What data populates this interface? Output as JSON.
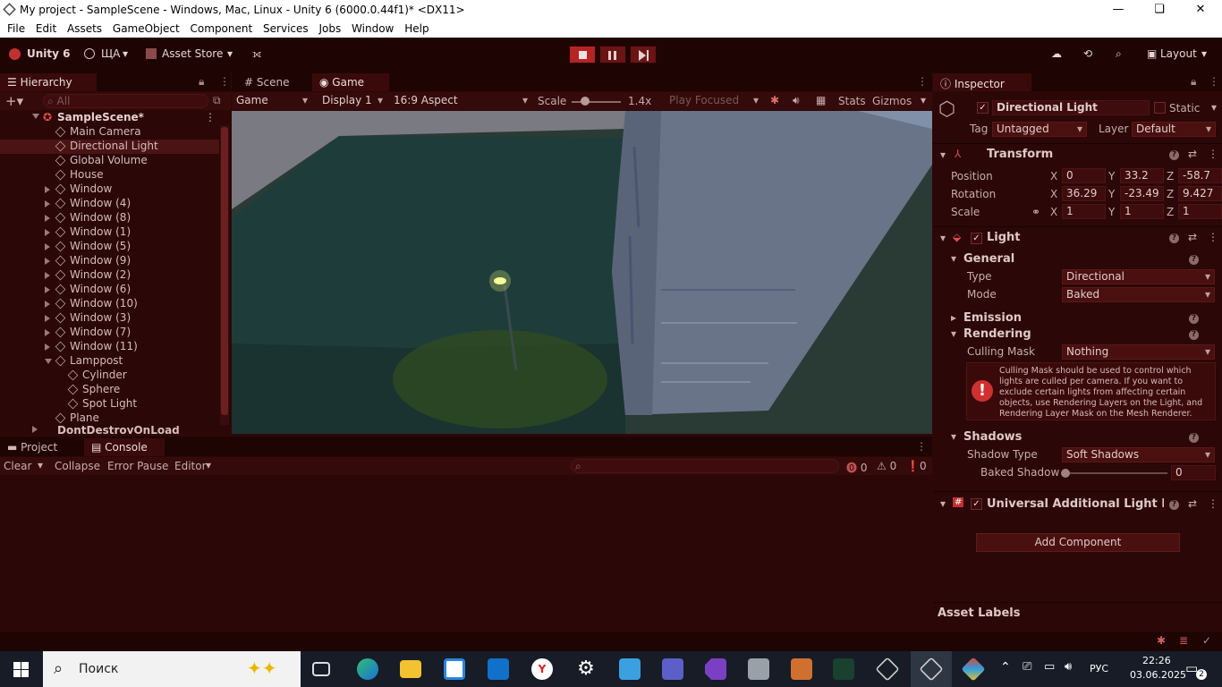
{
  "window": {
    "title": "My project - SampleScene - Windows, Mac, Linux - Unity 6 (6000.0.44f1)* <DX11>"
  },
  "menu": [
    "File",
    "Edit",
    "Assets",
    "GameObject",
    "Component",
    "Services",
    "Jobs",
    "Window",
    "Help"
  ],
  "toolbar": {
    "unity": "Unity 6",
    "account": "ЩА",
    "asset_store": "Asset Store",
    "layout": "Layout"
  },
  "hierarchy": {
    "tab": "Hierarchy",
    "search_placeholder": "All",
    "scene": "SampleScene*",
    "items": [
      {
        "label": "Main Camera",
        "indent": 1,
        "arrow": ""
      },
      {
        "label": "Directional Light",
        "indent": 1,
        "arrow": "",
        "selected": true
      },
      {
        "label": "Global Volume",
        "indent": 1,
        "arrow": ""
      },
      {
        "label": "House",
        "indent": 1,
        "arrow": ""
      },
      {
        "label": "Window",
        "indent": 1,
        "arrow": "right"
      },
      {
        "label": "Window (4)",
        "indent": 1,
        "arrow": "right"
      },
      {
        "label": "Window (8)",
        "indent": 1,
        "arrow": "right"
      },
      {
        "label": "Window (1)",
        "indent": 1,
        "arrow": "right"
      },
      {
        "label": "Window (5)",
        "indent": 1,
        "arrow": "right"
      },
      {
        "label": "Window (9)",
        "indent": 1,
        "arrow": "right"
      },
      {
        "label": "Window (2)",
        "indent": 1,
        "arrow": "right"
      },
      {
        "label": "Window (6)",
        "indent": 1,
        "arrow": "right"
      },
      {
        "label": "Window (10)",
        "indent": 1,
        "arrow": "right"
      },
      {
        "label": "Window (3)",
        "indent": 1,
        "arrow": "right"
      },
      {
        "label": "Window (7)",
        "indent": 1,
        "arrow": "right"
      },
      {
        "label": "Window (11)",
        "indent": 1,
        "arrow": "right"
      },
      {
        "label": "Lamppost",
        "indent": 1,
        "arrow": "down"
      },
      {
        "label": "Cylinder",
        "indent": 2,
        "arrow": ""
      },
      {
        "label": "Sphere",
        "indent": 2,
        "arrow": ""
      },
      {
        "label": "Spot Light",
        "indent": 2,
        "arrow": ""
      },
      {
        "label": "Plane",
        "indent": 1,
        "arrow": ""
      }
    ],
    "dont_destroy": "DontDestroyOnLoad"
  },
  "viewtabs": {
    "scene": "Scene",
    "game": "Game"
  },
  "gamebar": {
    "mode": "Game",
    "display": "Display 1",
    "aspect": "16:9 Aspect",
    "scale_label": "Scale",
    "scale_value": "1.4x",
    "play_focused": "Play Focused",
    "stats": "Stats",
    "gizmos": "Gizmos"
  },
  "bottom": {
    "project": "Project",
    "console": "Console",
    "clear": "Clear",
    "collapse": "Collapse",
    "error_pause": "Error Pause",
    "editor": "Editor",
    "errors": "0",
    "warnings": "0",
    "logs": "0"
  },
  "inspector": {
    "tab": "Inspector",
    "name": "Directional Light",
    "static": "Static",
    "tag_label": "Tag",
    "tag": "Untagged",
    "layer_label": "Layer",
    "layer": "Default",
    "transform": {
      "title": "Transform",
      "position": {
        "label": "Position",
        "x": "0",
        "y": "33.2",
        "z": "-58.7"
      },
      "rotation": {
        "label": "Rotation",
        "x": "36.29",
        "y": "-23.49",
        "z": "9.427"
      },
      "scale": {
        "label": "Scale",
        "x": "1",
        "y": "1",
        "z": "1"
      }
    },
    "light": {
      "title": "Light",
      "general": "General",
      "type_label": "Type",
      "type": "Directional",
      "mode_label": "Mode",
      "mode": "Baked",
      "emission": "Emission",
      "rendering": "Rendering",
      "culling_label": "Culling Mask",
      "culling": "Nothing",
      "warning": "Culling Mask should be used to control which lights are culled per camera. If you want to exclude certain lights from affecting certain objects, use Rendering Layers on the Light, and Rendering Layer Mask on the Mesh Renderer.",
      "shadows": "Shadows",
      "shadow_type_label": "Shadow Type",
      "shadow_type": "Soft Shadows",
      "baked_shadow_label": "Baked Shadow .",
      "baked_shadow": "0"
    },
    "urp": {
      "title": "Universal Additional Light Data"
    },
    "add_component": "Add Component",
    "asset_labels": "Asset Labels"
  },
  "taskbar": {
    "search": "Поиск",
    "lang": "РУС",
    "time": "22:26",
    "date": "03.06.2025",
    "notif": "2"
  }
}
